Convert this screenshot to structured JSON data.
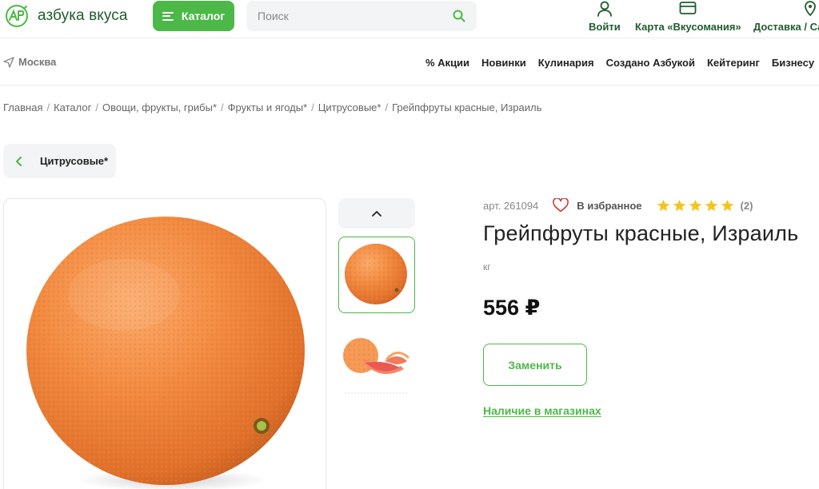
{
  "header": {
    "logo_text": "азбука вкуса",
    "catalog_label": "Каталог",
    "search_placeholder": "Поиск",
    "login_label": "Войти",
    "card_label": "Карта «Вкусомания»",
    "delivery_label": "Доставка / Са"
  },
  "subnav": {
    "city": "Москва",
    "links": [
      "% Акции",
      "Новинки",
      "Кулинария",
      "Создано Азбукой",
      "Кейтеринг",
      "Бизнесу"
    ]
  },
  "breadcrumb": [
    "Главная",
    "Каталог",
    "Овощи, фрукты, грибы*",
    "Фрукты и ягоды*",
    "Цитрусовые*",
    "Грейпфруты красные, Израиль"
  ],
  "breadcrumb_separator": "/",
  "back_chip_label": "Цитрусовые*",
  "product": {
    "article": "арт. 261094",
    "favorite_label": "В избранное",
    "rating_stars": 5,
    "reviews": "(2)",
    "title": "Грейпфруты красные, Израиль",
    "unit": "кг",
    "price": "556 ₽",
    "replace_label": "Заменить",
    "stores_link": "Наличие в магазинах"
  },
  "colors": {
    "brand_green": "#4cb848",
    "dark_green": "#1f5c2e",
    "star": "#f5c518"
  }
}
